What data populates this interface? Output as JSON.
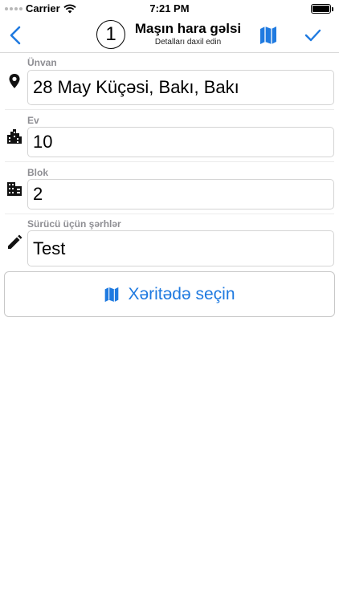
{
  "status_bar": {
    "carrier": "Carrier",
    "time": "7:21 PM"
  },
  "nav": {
    "step_number": "1",
    "title": "Maşın hara gəlsi",
    "subtitle": "Detalları daxil edin",
    "icons": {
      "back": "chevron-left-icon",
      "map": "map-icon",
      "done": "checkmark-icon"
    }
  },
  "form": {
    "address": {
      "label": "Ünvan",
      "value": "28 May Küçəsi, Bakı, Bakı",
      "icon": "location-pin-icon"
    },
    "house": {
      "label": "Ev",
      "value": "10",
      "icon": "city-icon"
    },
    "block": {
      "label": "Blok",
      "value": "2",
      "icon": "building-icon"
    },
    "driver_notes": {
      "label": "Sürücü üçün şərhlər",
      "value": "Test",
      "icon": "pencil-icon"
    }
  },
  "pick_on_map": {
    "label": "Xəritədə seçin",
    "icon": "map-icon"
  },
  "colors": {
    "accent": "#1f7ae0",
    "label_gray": "#8e8e93",
    "border": "#d4d4d4"
  }
}
